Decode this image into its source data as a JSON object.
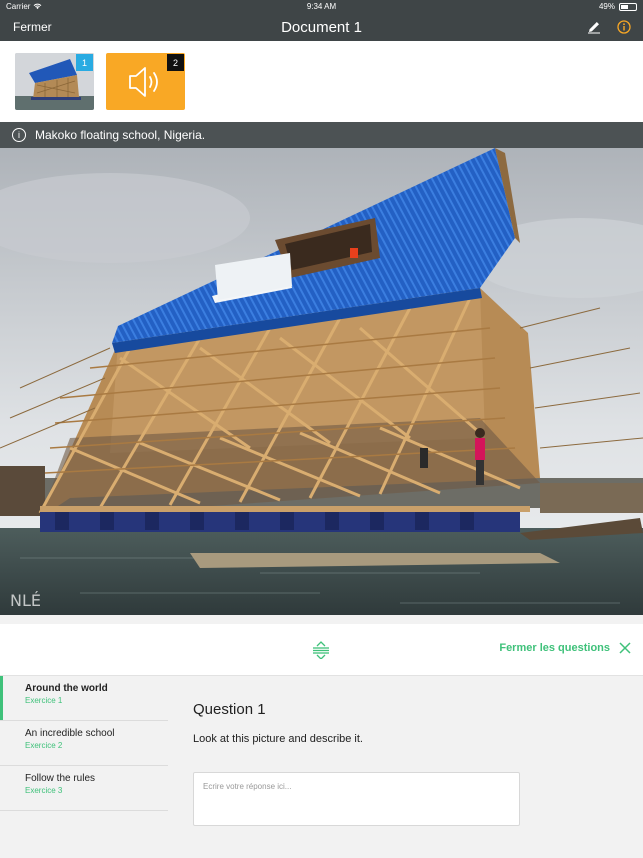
{
  "status": {
    "carrier": "Carrier",
    "time": "9:34 AM",
    "battery": "49%",
    "battery_level": 0.49
  },
  "nav": {
    "close_label": "Fermer",
    "title": "Document 1",
    "icons": [
      "pencil-icon",
      "info-icon"
    ]
  },
  "attachments": [
    {
      "badge": "1",
      "kind": "photo",
      "badge_color": "#29abe2"
    },
    {
      "badge": "2",
      "kind": "audio",
      "color": "#f9a825",
      "badge_color": "#111111"
    }
  ],
  "caption": {
    "text": "Makoko floating school, Nigeria."
  },
  "questions_bar": {
    "close_label": "Fermer les questions"
  },
  "exercises": [
    {
      "title": "Around the world",
      "subtitle": "Exercice 1",
      "active": true
    },
    {
      "title": "An incredible school",
      "subtitle": "Exercice 2",
      "active": false
    },
    {
      "title": "Follow the rules",
      "subtitle": "Exercice 3",
      "active": false
    }
  ],
  "question": {
    "title": "Question 1",
    "text": "Look at this picture and describe it.",
    "answer_placeholder": "Ecrire votre réponse ici...",
    "answer_value": ""
  },
  "colors": {
    "accent": "#3fc17a",
    "navbar": "#3f4547",
    "roof": "#1f5fbf",
    "audio": "#f9a825"
  }
}
